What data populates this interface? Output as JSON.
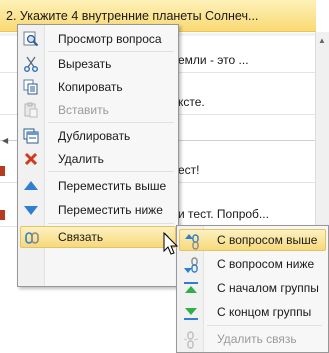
{
  "list": {
    "selected_row": "2. Укажите 4 внутренние планеты Солнеч...",
    "rows": [
      {
        "text": "емли - это ..."
      },
      {
        "text": "ксте."
      },
      {
        "text": "ест!"
      },
      {
        "text": "и тест. Попроб..."
      }
    ]
  },
  "context_menu": {
    "items": [
      {
        "label": "Просмотр вопроса",
        "icon": "preview-icon"
      },
      {
        "label": "Вырезать",
        "icon": "scissors-icon"
      },
      {
        "label": "Копировать",
        "icon": "copy-icon"
      },
      {
        "label": "Вставить",
        "icon": "paste-icon",
        "disabled": true
      },
      {
        "label": "Дублировать",
        "icon": "duplicate-icon"
      },
      {
        "label": "Удалить",
        "icon": "delete-icon"
      },
      {
        "label": "Переместить выше",
        "icon": "arrow-up-icon"
      },
      {
        "label": "Переместить ниже",
        "icon": "arrow-down-icon"
      },
      {
        "label": "Связать",
        "icon": "link-icon",
        "highlighted": true,
        "has_submenu": true
      }
    ]
  },
  "submenu": {
    "items": [
      {
        "label": "С вопросом выше",
        "icon": "link-up-icon",
        "highlighted": true
      },
      {
        "label": "С вопросом ниже",
        "icon": "link-down-icon"
      },
      {
        "label": "С началом группы",
        "icon": "link-group-start-icon"
      },
      {
        "label": "С концом группы",
        "icon": "link-group-end-icon"
      },
      {
        "label": "Удалить связь",
        "icon": "unlink-icon",
        "disabled": true
      }
    ]
  },
  "colors": {
    "highlight_top": "#fdf1c2",
    "highlight_bottom": "#f6d97a",
    "selected_row": "#f9d973",
    "accent_blue": "#2f7fd1",
    "delete_red": "#d23a1d"
  }
}
